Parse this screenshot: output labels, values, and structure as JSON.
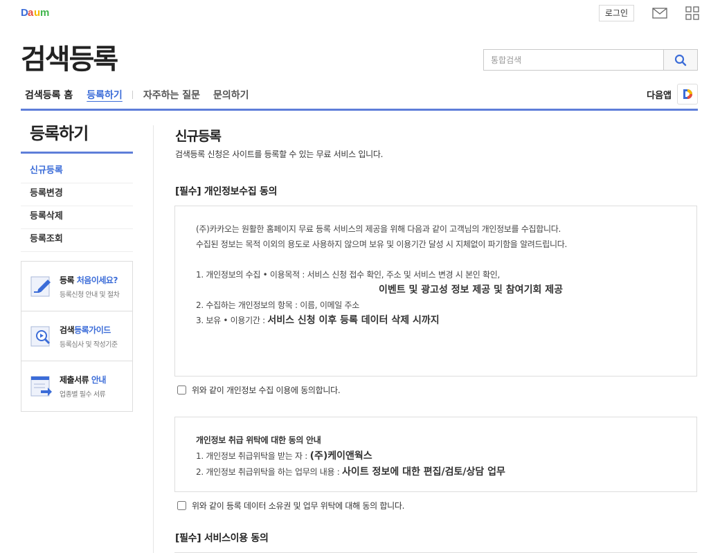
{
  "header": {
    "logo_text": "Daum",
    "login_label": "로그인",
    "page_title": "검색등록",
    "search_placeholder": "통합검색"
  },
  "gnb": {
    "home": "검색등록 홈",
    "register": "등록하기",
    "faq": "자주하는 질문",
    "inquiry": "문의하기",
    "daum_app": "다음앱"
  },
  "sidebar": {
    "title": "등록하기",
    "items": [
      {
        "label": "신규등록"
      },
      {
        "label": "등록변경"
      },
      {
        "label": "등록삭제"
      },
      {
        "label": "등록조회"
      }
    ],
    "guides": [
      {
        "title_a": "등록 ",
        "title_b": "처음이세요?",
        "sub": "등록신청 안내 및 절차"
      },
      {
        "title_a": "검색",
        "title_b": "등록가이드",
        "sub": "등록심사 및 작성기준"
      },
      {
        "title_a": "제출서류 ",
        "title_b": "안내",
        "sub": "업종별 필수 서류"
      }
    ]
  },
  "content": {
    "title": "신규등록",
    "desc": "검색등록 신청은 사이트를 등록할 수 있는 무료 서비스 입니다.",
    "privacy": {
      "title": "[필수] 개인정보수집 동의",
      "line1": "(주)카카오는 원활한 홈페이지 무료 등록 서비스의 제공을 위해 다음과 같이 고객님의 개인정보를 수집합니다.",
      "line2": "수집된 정보는 목적 이외의 용도로 사용하지 않으며 보유 및 이용기간 달성 시 지체없이 파기함을 알려드립니다.",
      "item1": "1. 개인정보의 수집 • 이용목적 : 서비스 신청 접수 확인, 주소 및 서비스 변경 시 본인 확인,",
      "item1b": "이벤트 및 광고성 정보 제공 및 참여기회 제공",
      "item2": "2. 수집하는 개인정보의 항목 : 이름, 이메일 주소",
      "item3a": "3. 보유 • 이용기간 : ",
      "item3b": "서비스 신청 이후 등록 데이터 삭제 시까지",
      "agree": "위와 같이 개인정보 수집 이용에 동의합니다."
    },
    "consign": {
      "head": "개인정보 취급 위탁에 대한 동의 안내",
      "item1a": "1. 개인정보 취급위탁을 받는 자 : ",
      "item1b": "(주)케이앤웍스",
      "item2a": "2. 개인정보 취급위탁을 하는 업무의 내용 : ",
      "item2b": "사이트 정보에 대한 편집/검토/상담 업무",
      "agree": "위와 같이 등록 데이터 소유권 및 업무 위탁에 대해 동의 합니다."
    },
    "service": {
      "title": "[필수] 서비스이용 동의"
    }
  }
}
